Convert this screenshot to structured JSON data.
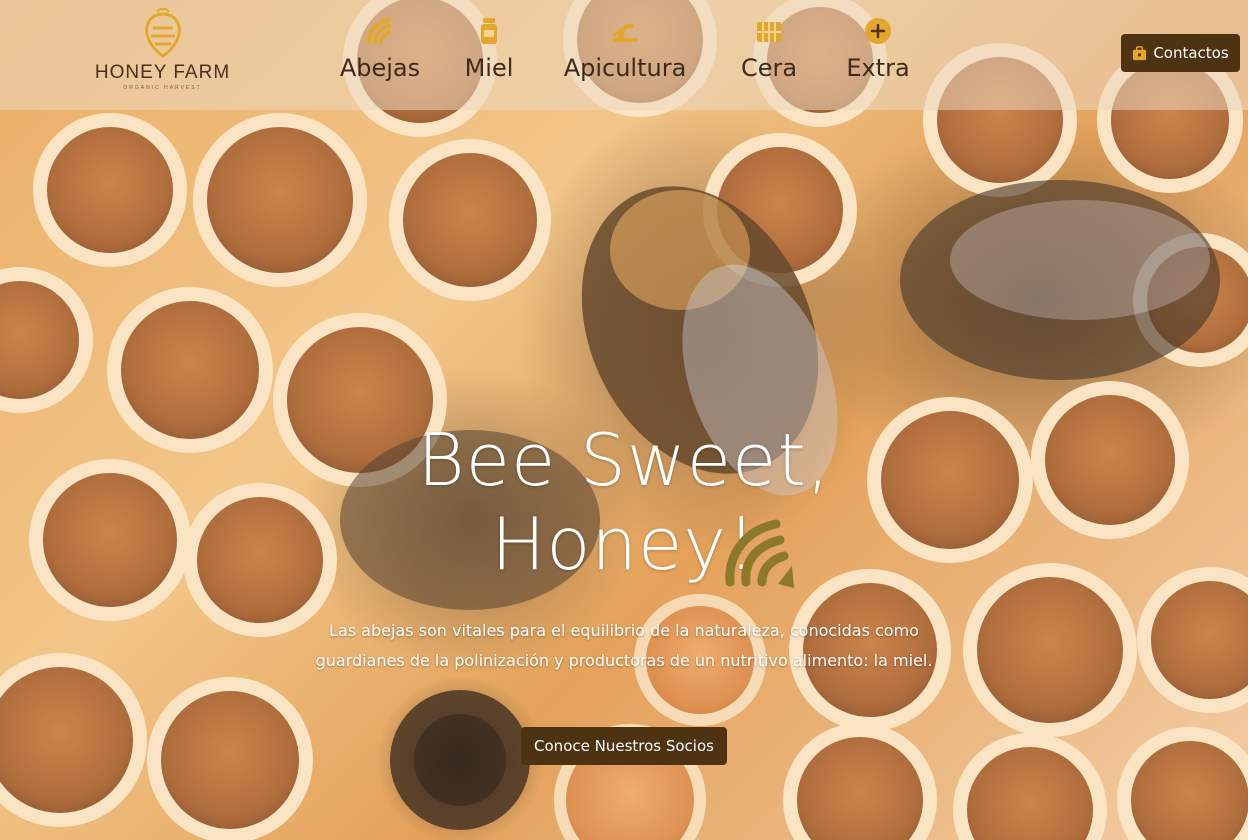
{
  "brand": {
    "name": "HONEY FARM",
    "tagline": "ORGANIC HARVEST",
    "logo_icon": "bee-honey-logo-icon",
    "accent_color": "#e3a72f",
    "dark_color": "#4e3312"
  },
  "nav": {
    "items": [
      {
        "label": "Abejas",
        "icon": "honey-stripe-icon"
      },
      {
        "label": "Miel",
        "icon": "honey-jar-icon"
      },
      {
        "label": "Apicultura",
        "icon": "beekeeper-hive-icon"
      },
      {
        "label": "Cera",
        "icon": "wax-comb-icon"
      },
      {
        "label": "Extra",
        "icon": "plus-circle-icon"
      }
    ],
    "contact_label": "Contactos",
    "contact_icon": "briefcase-icon"
  },
  "hero": {
    "headline_line1": "Bee Sweet,",
    "headline_line2": "Honey!",
    "description": "Las abejas son vitales para el equilibrio de la naturaleza, conocidas como guardianes de la polinización y productoras de un nutritivo alimento: la miel.",
    "cta_label": "Conoce Nuestros Socios",
    "background": "honeycomb-with-bees-photo"
  }
}
